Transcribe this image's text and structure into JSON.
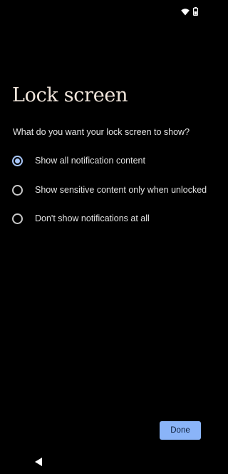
{
  "status_bar": {
    "icons": [
      "wifi-icon",
      "battery-icon"
    ]
  },
  "screen": {
    "title": "Lock screen",
    "question": "What do you want your lock screen to show?"
  },
  "options": [
    {
      "label": "Show all notification content",
      "selected": true
    },
    {
      "label": "Show sensitive content only when unlocked",
      "selected": false
    },
    {
      "label": "Don't show notifications at all",
      "selected": false
    }
  ],
  "actions": {
    "done_label": "Done"
  },
  "navigation": {
    "icons": [
      "back-icon"
    ]
  },
  "colors": {
    "background": "#000000",
    "accent": "#a8c7fa",
    "button": "#8ab4f8",
    "title": "#f1e6dc"
  }
}
